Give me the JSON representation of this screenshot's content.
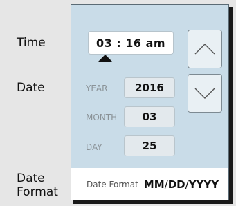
{
  "labels": {
    "time": "Time",
    "date": "Date",
    "date_format_line1": "Date",
    "date_format_line2": "Format"
  },
  "time": {
    "value": "03 : 16  am"
  },
  "buttons": {
    "increment_icon": "chevron-up-icon",
    "decrement_icon": "chevron-down-icon"
  },
  "date": {
    "year_label": "YEAR",
    "year_value": "2016",
    "month_label": "MONTH",
    "month_value": "03",
    "day_label": "DAY",
    "day_value": "25"
  },
  "format": {
    "label": "Date Format",
    "mm": "MM",
    "sep1": "/",
    "dd": "DD",
    "sep2": "/",
    "yyyy": "YYYY"
  },
  "colors": {
    "panel_background": "#c9dce8",
    "page_background": "#e6e6e6"
  }
}
